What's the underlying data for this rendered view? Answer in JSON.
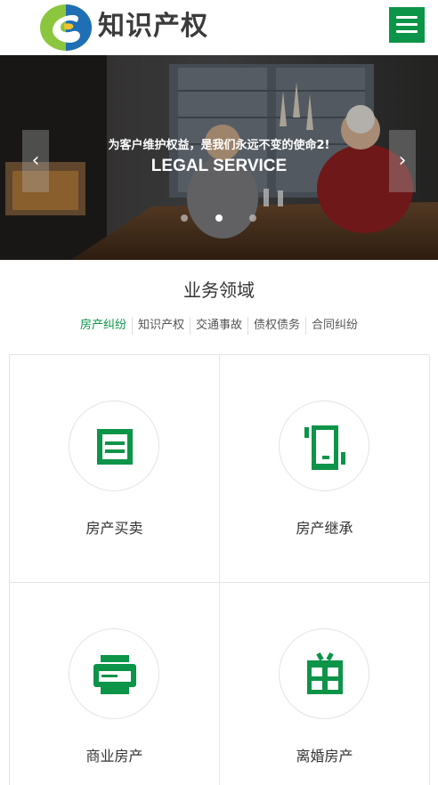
{
  "header": {
    "brand": "知识产权",
    "logo_icon": "logo-swirl-icon",
    "menu_icon": "hamburger-menu-icon",
    "brand_color": "#0c9448"
  },
  "banner": {
    "subtitle": "为客户维护权益，是我们永远不变的使命2!",
    "title": "LEGAL SERVICE",
    "prev_icon": "chevron-left-icon",
    "next_icon": "chevron-right-icon",
    "slide_count": 3,
    "active_slide": 2
  },
  "section": {
    "title": "业务领域",
    "tabs": [
      {
        "label": "房产纠纷",
        "active": true
      },
      {
        "label": "知识产权",
        "active": false
      },
      {
        "label": "交通事故",
        "active": false
      },
      {
        "label": "债权债务",
        "active": false
      },
      {
        "label": "合同纠纷",
        "active": false
      }
    ]
  },
  "services": [
    {
      "label": "房产买卖",
      "icon": "document-box-icon"
    },
    {
      "label": "房产继承",
      "icon": "phone-device-icon"
    },
    {
      "label": "商业房产",
      "icon": "printer-icon"
    },
    {
      "label": "离婚房产",
      "icon": "gift-box-icon"
    }
  ]
}
